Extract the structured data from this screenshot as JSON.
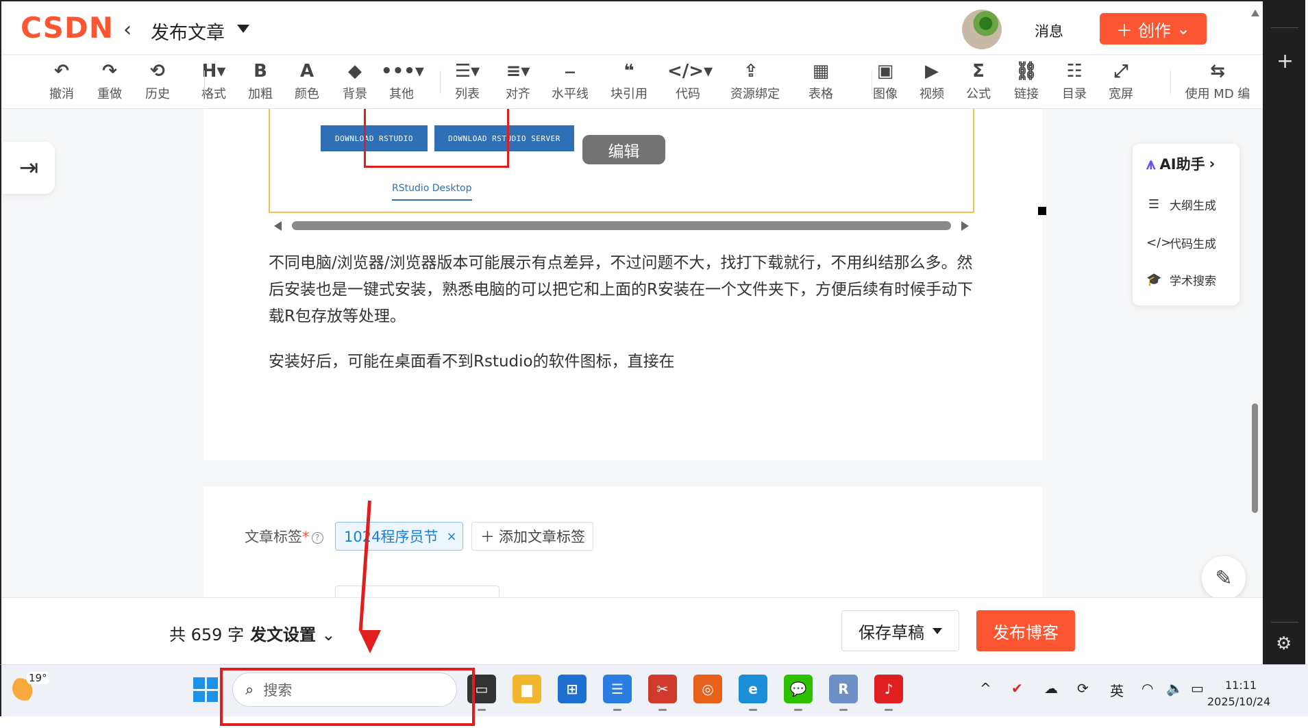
{
  "header": {
    "logo_text": "CSDN",
    "back_icon": "chevron-left-icon",
    "title": "发布文章",
    "avatar": "user-avatar",
    "messages_label": "消息",
    "create_label": "创作",
    "brand_color": "#fc5531"
  },
  "toolbar": {
    "items": [
      {
        "icon": "↶",
        "label": "撤消"
      },
      {
        "icon": "↷",
        "label": "重做"
      },
      {
        "icon": "⟲",
        "label": "历史"
      },
      {
        "icon": "H▾",
        "label": "格式"
      },
      {
        "icon": "B",
        "label": "加粗"
      },
      {
        "icon": "A",
        "label": "颜色"
      },
      {
        "icon": "◆",
        "label": "背景"
      },
      {
        "icon": "•••▾",
        "label": "其他"
      },
      {
        "icon": "☰▾",
        "label": "列表"
      },
      {
        "icon": "≡▾",
        "label": "对齐"
      },
      {
        "icon": "⎯",
        "label": "水平线"
      },
      {
        "icon": "❝",
        "label": "块引用"
      },
      {
        "icon": "</>▾",
        "label": "代码"
      },
      {
        "icon": "⇪",
        "label": "资源绑定"
      },
      {
        "icon": "▦",
        "label": "表格"
      },
      {
        "icon": "▣",
        "label": "图像"
      },
      {
        "icon": "▶",
        "label": "视频"
      },
      {
        "icon": "Σ",
        "label": "公式"
      },
      {
        "icon": "⛓",
        "label": "链接"
      },
      {
        "icon": "☷",
        "label": "目录"
      },
      {
        "icon": "⤢",
        "label": "宽屏"
      },
      {
        "icon": "⇆",
        "label": "使用 MD 编"
      }
    ]
  },
  "embed": {
    "download_rstudio": "DOWNLOAD RSTUDIO",
    "download_server": "DOWNLOAD RSTUDIO SERVER",
    "edit_chip": "编辑",
    "tab_label": "RStudio Desktop"
  },
  "article": {
    "paragraph1": "不同电脑/浏览器/浏览器版本可能展示有点差异，不过问题不大，找打下载就行，不用纠结那么多。然后安装也是一键式安装，熟悉电脑的可以把它和上面的R安装在一个文件夹下，方便后续有时候手动下载R包存放等处理。",
    "paragraph2": "安装好后，可能在桌面看不到Rstudio的软件图标，直接在"
  },
  "tags": {
    "label": "文章标签",
    "required_mark": "*",
    "help_glyph": "?",
    "tag_value": "1024程序员节",
    "remove_glyph": "×",
    "add_label": "添加文章标签"
  },
  "ai_panel": {
    "title": "AI助手",
    "items": [
      {
        "icon": "☰",
        "label": "大纲生成"
      },
      {
        "icon": "</>",
        "label": "代码生成"
      },
      {
        "icon": "🎓",
        "label": "学术搜索"
      }
    ]
  },
  "bottombar": {
    "word_count": "共 659 字",
    "settings_label": "发文设置",
    "save_draft": "保存草稿",
    "publish": "发布博客"
  },
  "taskbar": {
    "weather_temp": "19°",
    "search_placeholder": "搜索",
    "apps": [
      {
        "name": "task-view",
        "glyph": "▭",
        "color": "#333333"
      },
      {
        "name": "file-explorer",
        "glyph": "▆",
        "color": "#f2b631"
      },
      {
        "name": "microsoft-store",
        "glyph": "⊞",
        "color": "#1f6fd1"
      },
      {
        "name": "notepad",
        "glyph": "☰",
        "color": "#2b7de0"
      },
      {
        "name": "snipping-tool",
        "glyph": "✂",
        "color": "#cf3a2c"
      },
      {
        "name": "ubuntu-terminal",
        "glyph": "◎",
        "color": "#e8611a"
      },
      {
        "name": "edge-browser",
        "glyph": "e",
        "color": "#1a8fd8"
      },
      {
        "name": "wechat",
        "glyph": "💬",
        "color": "#2dc100"
      },
      {
        "name": "r-gui",
        "glyph": "R",
        "color": "#6f8fc7"
      },
      {
        "name": "music-app",
        "glyph": "♪",
        "color": "#e02020"
      }
    ],
    "tray": {
      "chevron": "^",
      "ime": "英",
      "time": "11:11",
      "date": "2025/10/24"
    }
  }
}
